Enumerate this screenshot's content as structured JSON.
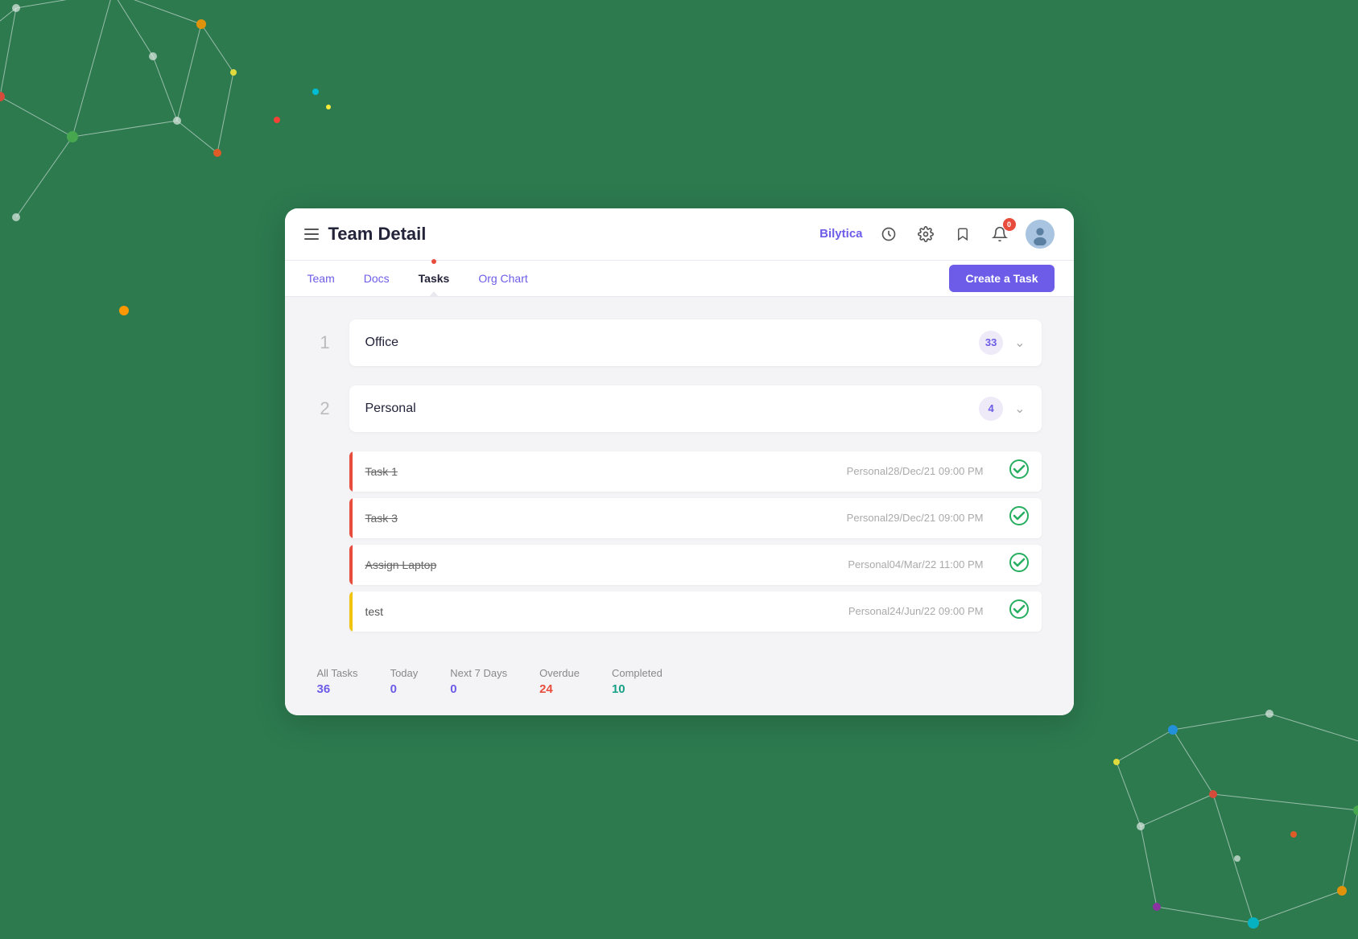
{
  "header": {
    "menu_icon": "hamburger",
    "title": "Team Detail",
    "brand": "Bilytica",
    "icons": [
      "clock-icon",
      "settings-icon",
      "bookmark-icon",
      "notification-icon"
    ],
    "notification_count": "0",
    "avatar_alt": "user avatar"
  },
  "tabs": {
    "items": [
      {
        "label": "Team",
        "active": false
      },
      {
        "label": "Docs",
        "active": false
      },
      {
        "label": "Tasks",
        "active": true
      },
      {
        "label": "Org Chart",
        "active": false
      }
    ],
    "create_button": "Create a Task"
  },
  "categories": [
    {
      "number": "1",
      "name": "Office",
      "count": "33",
      "expanded": false
    },
    {
      "number": "2",
      "name": "Personal",
      "count": "4",
      "expanded": true
    }
  ],
  "tasks": [
    {
      "name": "Task 1",
      "meta": "Personal28/Dec/21 09:00 PM",
      "priority": "red",
      "completed": true,
      "strikethrough": true
    },
    {
      "name": "Task 3",
      "meta": "Personal29/Dec/21 09:00 PM",
      "priority": "red",
      "completed": true,
      "strikethrough": true
    },
    {
      "name": "Assign Laptop",
      "meta": "Personal04/Mar/22 11:00 PM",
      "priority": "red",
      "completed": true,
      "strikethrough": true
    },
    {
      "name": "test",
      "meta": "Personal24/Jun/22 09:00 PM",
      "priority": "yellow",
      "completed": true,
      "strikethrough": false
    }
  ],
  "footer": {
    "stats": [
      {
        "label": "All Tasks",
        "value": "36",
        "color": "blue"
      },
      {
        "label": "Today",
        "value": "0",
        "color": "blue"
      },
      {
        "label": "Next 7 Days",
        "value": "0",
        "color": "blue"
      },
      {
        "label": "Overdue",
        "value": "24",
        "color": "red"
      },
      {
        "label": "Completed",
        "value": "10",
        "color": "teal"
      }
    ]
  }
}
